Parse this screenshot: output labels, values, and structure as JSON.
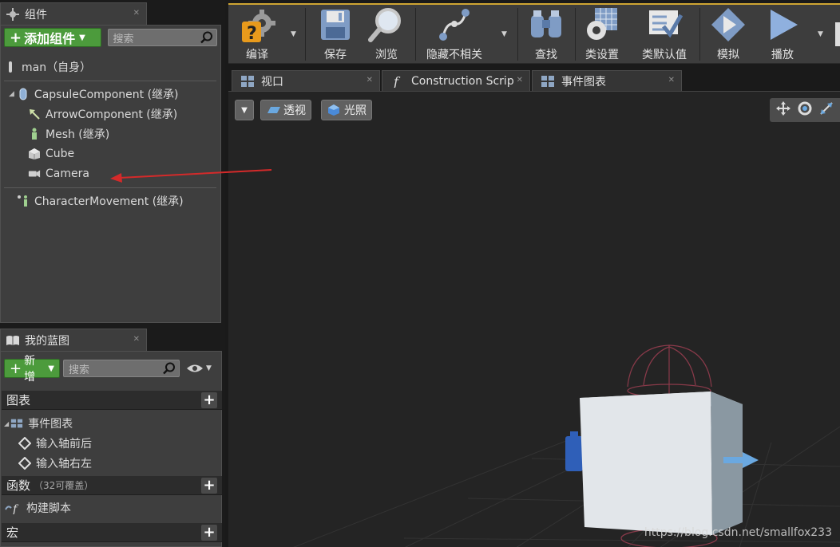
{
  "components_panel": {
    "tab_title": "组件",
    "add_button": "添加组件",
    "search_placeholder": "搜索",
    "root": "man（自身）",
    "tree": [
      {
        "label": "CapsuleComponent (继承)",
        "icon": "capsule-icon"
      },
      {
        "label": "ArrowComponent (继承)",
        "icon": "arrow-icon"
      },
      {
        "label": "Mesh (继承)",
        "icon": "mesh-icon"
      },
      {
        "label": "Cube",
        "icon": "cube-icon"
      },
      {
        "label": "Camera",
        "icon": "camera-icon"
      },
      {
        "label": "CharacterMovement (继承)",
        "icon": "movement-icon"
      }
    ]
  },
  "blueprint_panel": {
    "tab_title": "我的蓝图",
    "add_button": "新增",
    "search_placeholder": "搜索",
    "sections": {
      "graphs": "图表",
      "event_graph": "事件图表",
      "event_items": [
        "输入轴前后",
        "输入轴右左"
      ],
      "functions": "函数",
      "functions_sub": "（32可覆盖）",
      "construction": "构建脚本",
      "macros": "宏"
    }
  },
  "toolbar": {
    "buttons": [
      "编译",
      "保存",
      "浏览",
      "隐藏不相关",
      "查找",
      "类设置",
      "类默认值",
      "模拟",
      "播放"
    ]
  },
  "doc_tabs": [
    "视口",
    "Construction Scrip",
    "事件图表"
  ],
  "viewport": {
    "perspective": "透视",
    "lighting": "光照"
  },
  "watermark": "https://blog.csdn.net/smallfox233",
  "colors": {
    "accent": "#cfa533",
    "add_green": "#4c9b3c",
    "annotation_arrow": "#d42a2a"
  }
}
